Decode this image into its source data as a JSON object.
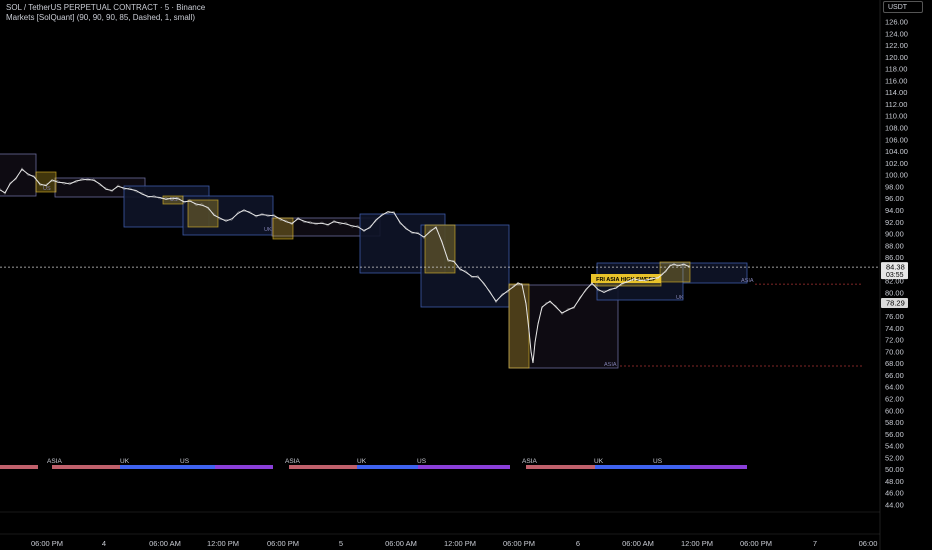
{
  "legend": {
    "symbol_line": "SOL / TetherUS PERPETUAL CONTRACT · 5 · Binance",
    "indicator_line": "Markets [SolQuant] (90, 90, 90, 85, Dashed, 1, small)"
  },
  "currency_label": "USDT",
  "colors": {
    "background": "#000000",
    "price_line": "#e6e6e6",
    "asia_box_border": "#6b6b9a",
    "uk_box_border": "#3d5aa8",
    "us_box_border": "#3d5aa8",
    "us_box_fill": "#0e1428",
    "asia_box_fill": "#0f0c14",
    "yellow": "#e8c22a",
    "asia_bar": "#c0606b",
    "uk_bar": "#3f63f0",
    "us_bar": "#8a3fd9"
  },
  "chart_data": {
    "type": "line",
    "ylim": [
      42,
      128
    ],
    "y_ticks": [
      "44.00",
      "46.00",
      "48.00",
      "50.00",
      "52.00",
      "54.00",
      "56.00",
      "58.00",
      "60.00",
      "62.00",
      "64.00",
      "66.00",
      "68.00",
      "70.00",
      "72.00",
      "74.00",
      "76.00",
      "78.00",
      "80.00",
      "82.00",
      "84.00",
      "86.00",
      "88.00",
      "90.00",
      "92.00",
      "94.00",
      "96.00",
      "98.00",
      "100.00",
      "102.00",
      "104.00",
      "106.00",
      "108.00",
      "110.00",
      "112.00",
      "114.00",
      "116.00",
      "118.00",
      "120.00",
      "122.00",
      "124.00",
      "126.00"
    ],
    "x_ticks": [
      "06:00 PM",
      "4",
      "06:00 AM",
      "12:00 PM",
      "06:00 PM",
      "5",
      "06:00 AM",
      "12:00 PM",
      "06:00 PM",
      "6",
      "06:00 AM",
      "12:00 PM",
      "06:00 PM",
      "7",
      "06:00"
    ],
    "last_price": {
      "value": "84.38",
      "countdown": "03:55"
    },
    "secondary_price": "78.29",
    "series": [
      {
        "points": [
          [
            0,
            97.5
          ],
          [
            5,
            97
          ],
          [
            10,
            98.5
          ],
          [
            16,
            99.5
          ],
          [
            22,
            101
          ],
          [
            28,
            100.2
          ],
          [
            34,
            99.7
          ],
          [
            40,
            98.5
          ],
          [
            46,
            98.2
          ],
          [
            52,
            99.2
          ],
          [
            58,
            98.8
          ],
          [
            64,
            98.7
          ],
          [
            70,
            98.5
          ],
          [
            76,
            99
          ],
          [
            82,
            99.2
          ],
          [
            88,
            99.3
          ],
          [
            94,
            99.1
          ],
          [
            100,
            98.5
          ],
          [
            106,
            97.6
          ],
          [
            112,
            97.4
          ],
          [
            118,
            98.1
          ],
          [
            124,
            97.8
          ],
          [
            130,
            97.6
          ],
          [
            136,
            97.4
          ],
          [
            142,
            96.8
          ],
          [
            148,
            96.4
          ],
          [
            154,
            96.3
          ],
          [
            160,
            96.2
          ],
          [
            166,
            95.9
          ],
          [
            172,
            96.1
          ],
          [
            178,
            96
          ],
          [
            184,
            95.5
          ],
          [
            190,
            95.6
          ],
          [
            196,
            95.1
          ],
          [
            202,
            94.9
          ],
          [
            208,
            94.5
          ],
          [
            214,
            93.2
          ],
          [
            220,
            92.7
          ],
          [
            226,
            92.2
          ],
          [
            232,
            92.6
          ],
          [
            238,
            93.5
          ],
          [
            244,
            94.1
          ],
          [
            250,
            93.6
          ],
          [
            256,
            93.1
          ],
          [
            262,
            93.3
          ],
          [
            268,
            93.2
          ],
          [
            274,
            93.1
          ],
          [
            280,
            92.6
          ],
          [
            286,
            92.1
          ],
          [
            292,
            91.8
          ],
          [
            298,
            92.6
          ],
          [
            304,
            92.2
          ],
          [
            310,
            91.9
          ],
          [
            316,
            91.8
          ],
          [
            322,
            91.8
          ],
          [
            328,
            91.6
          ],
          [
            334,
            92.1
          ],
          [
            340,
            91.9
          ],
          [
            346,
            91.7
          ],
          [
            352,
            91.4
          ],
          [
            358,
            91.2
          ],
          [
            364,
            90.6
          ],
          [
            370,
            91.1
          ],
          [
            376,
            92.4
          ],
          [
            382,
            93.2
          ],
          [
            388,
            93.8
          ],
          [
            394,
            93.6
          ],
          [
            400,
            92
          ],
          [
            406,
            90.9
          ],
          [
            412,
            90.3
          ],
          [
            418,
            90.1
          ],
          [
            424,
            89.5
          ],
          [
            430,
            90.4
          ],
          [
            436,
            91.2
          ],
          [
            442,
            88.6
          ],
          [
            448,
            85.6
          ],
          [
            454,
            85.3
          ],
          [
            460,
            84.1
          ],
          [
            466,
            83.5
          ],
          [
            472,
            82.8
          ],
          [
            478,
            82.7
          ],
          [
            484,
            81.6
          ],
          [
            490,
            80.1
          ],
          [
            496,
            78.6
          ],
          [
            502,
            79.6
          ],
          [
            508,
            80.4
          ],
          [
            514,
            81.1
          ],
          [
            518,
            81.7
          ],
          [
            522,
            81.4
          ],
          [
            526,
            78.2
          ],
          [
            529,
            73.6
          ],
          [
            531,
            70.1
          ],
          [
            533,
            68.1
          ],
          [
            535,
            71.6
          ],
          [
            538,
            74.7
          ],
          [
            542,
            77.6
          ],
          [
            546,
            78.1
          ],
          [
            550,
            78.6
          ],
          [
            556,
            77.6
          ],
          [
            562,
            76.6
          ],
          [
            568,
            77.1
          ],
          [
            574,
            77.6
          ],
          [
            580,
            79.1
          ],
          [
            586,
            80.6
          ],
          [
            592,
            81.6
          ],
          [
            598,
            80.6
          ],
          [
            604,
            80.1
          ],
          [
            610,
            80.6
          ],
          [
            616,
            80.8
          ],
          [
            622,
            81.6
          ],
          [
            628,
            81.9
          ],
          [
            634,
            82.4
          ],
          [
            640,
            82.1
          ],
          [
            646,
            82.2
          ],
          [
            652,
            82.4
          ],
          [
            658,
            82.6
          ],
          [
            662,
            83.1
          ],
          [
            666,
            83.8
          ],
          [
            670,
            84.6
          ],
          [
            674,
            84.9
          ],
          [
            678,
            84.6
          ],
          [
            684,
            84.9
          ],
          [
            690,
            84.38
          ]
        ]
      }
    ]
  },
  "annotations": {
    "sweep_label": "FRI ASIA HIGH SWEEP",
    "small_labels": [
      "ASIA",
      "UK",
      "US",
      "UK",
      "ASIA",
      "US"
    ],
    "session_bar_labels": [
      "ASIA",
      "UK",
      "US",
      "ASIA",
      "UK",
      "US",
      "ASIA",
      "UK",
      "US"
    ]
  }
}
